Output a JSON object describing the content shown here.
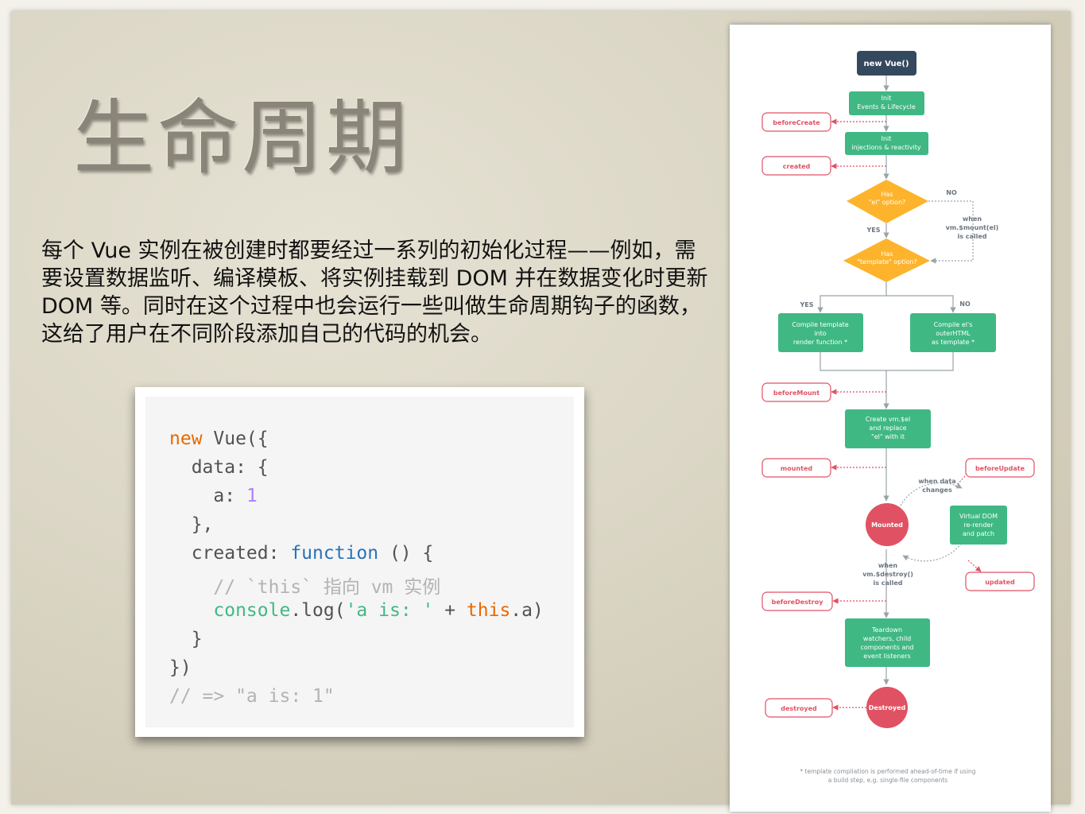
{
  "slide": {
    "title": "生命周期",
    "description": "每个 Vue 实例在被创建时都要经过一系列的初始化过程——例如，需要设置数据监听、编译模板、将实例挂载到 DOM 并在数据变化时更新 DOM 等。同时在这个过程中也会运行一些叫做生命周期钩子的函数，这给了用户在不同阶段添加自己的代码的机会。"
  },
  "code": {
    "l1_kw": "new",
    "l1_rest": " Vue({",
    "l2": "  data: {",
    "l3_key": "    a: ",
    "l3_num": "1",
    "l4": "  },",
    "l5_key": "  created: ",
    "l5_kw": "function",
    "l5_rest": " () {",
    "l6": "    // `this` 指向 vm 实例",
    "l7_console": "    console",
    "l7_log": ".log(",
    "l7_str": "'a is: '",
    "l7_plus": " + ",
    "l7_this": "this",
    "l7_end": ".a)",
    "l8": "  }",
    "l9": "})",
    "l10": "// => \"a is: 1\""
  },
  "diagram": {
    "colors": {
      "dark": "#35495e",
      "green": "#3fb884",
      "yellow": "#fdb42c",
      "red": "#e05263",
      "line": "#9aa3ab"
    },
    "new_vue": "new Vue()",
    "init_events": [
      "Init",
      "Events & Lifecycle"
    ],
    "init_injections": [
      "Init",
      "injections & reactivity"
    ],
    "has_el": [
      "Has",
      "\"el\" option?"
    ],
    "has_template": [
      "Has",
      "\"template\" option?"
    ],
    "compile_template": [
      "Compile template",
      "into",
      "render function *"
    ],
    "compile_outer": [
      "Compile el's",
      "outerHTML",
      "as template *"
    ],
    "create_el": [
      "Create vm.$el",
      "and replace",
      "\"el\" with it"
    ],
    "mounted_state": "Mounted",
    "virtual_dom": [
      "Virtual DOM",
      "re-render",
      "and patch"
    ],
    "teardown": [
      "Teardown",
      "watchers, child",
      "components and",
      "event listeners"
    ],
    "destroyed_state": "Destroyed",
    "when_mount": [
      "when",
      "vm.$mount(el)",
      "is called"
    ],
    "when_data": [
      "when data",
      "changes"
    ],
    "when_destroy": [
      "when",
      "vm.$destroy()",
      "is called"
    ],
    "yes": "YES",
    "no": "NO",
    "hooks": {
      "before_create": "beforeCreate",
      "created": "created",
      "before_mount": "beforeMount",
      "mounted": "mounted",
      "before_update": "beforeUpdate",
      "updated": "updated",
      "before_destroy": "beforeDestroy",
      "destroyed": "destroyed"
    },
    "footnote": [
      "* template compilation is performed ahead-of-time if using",
      "a build step, e.g. single-file components"
    ]
  }
}
